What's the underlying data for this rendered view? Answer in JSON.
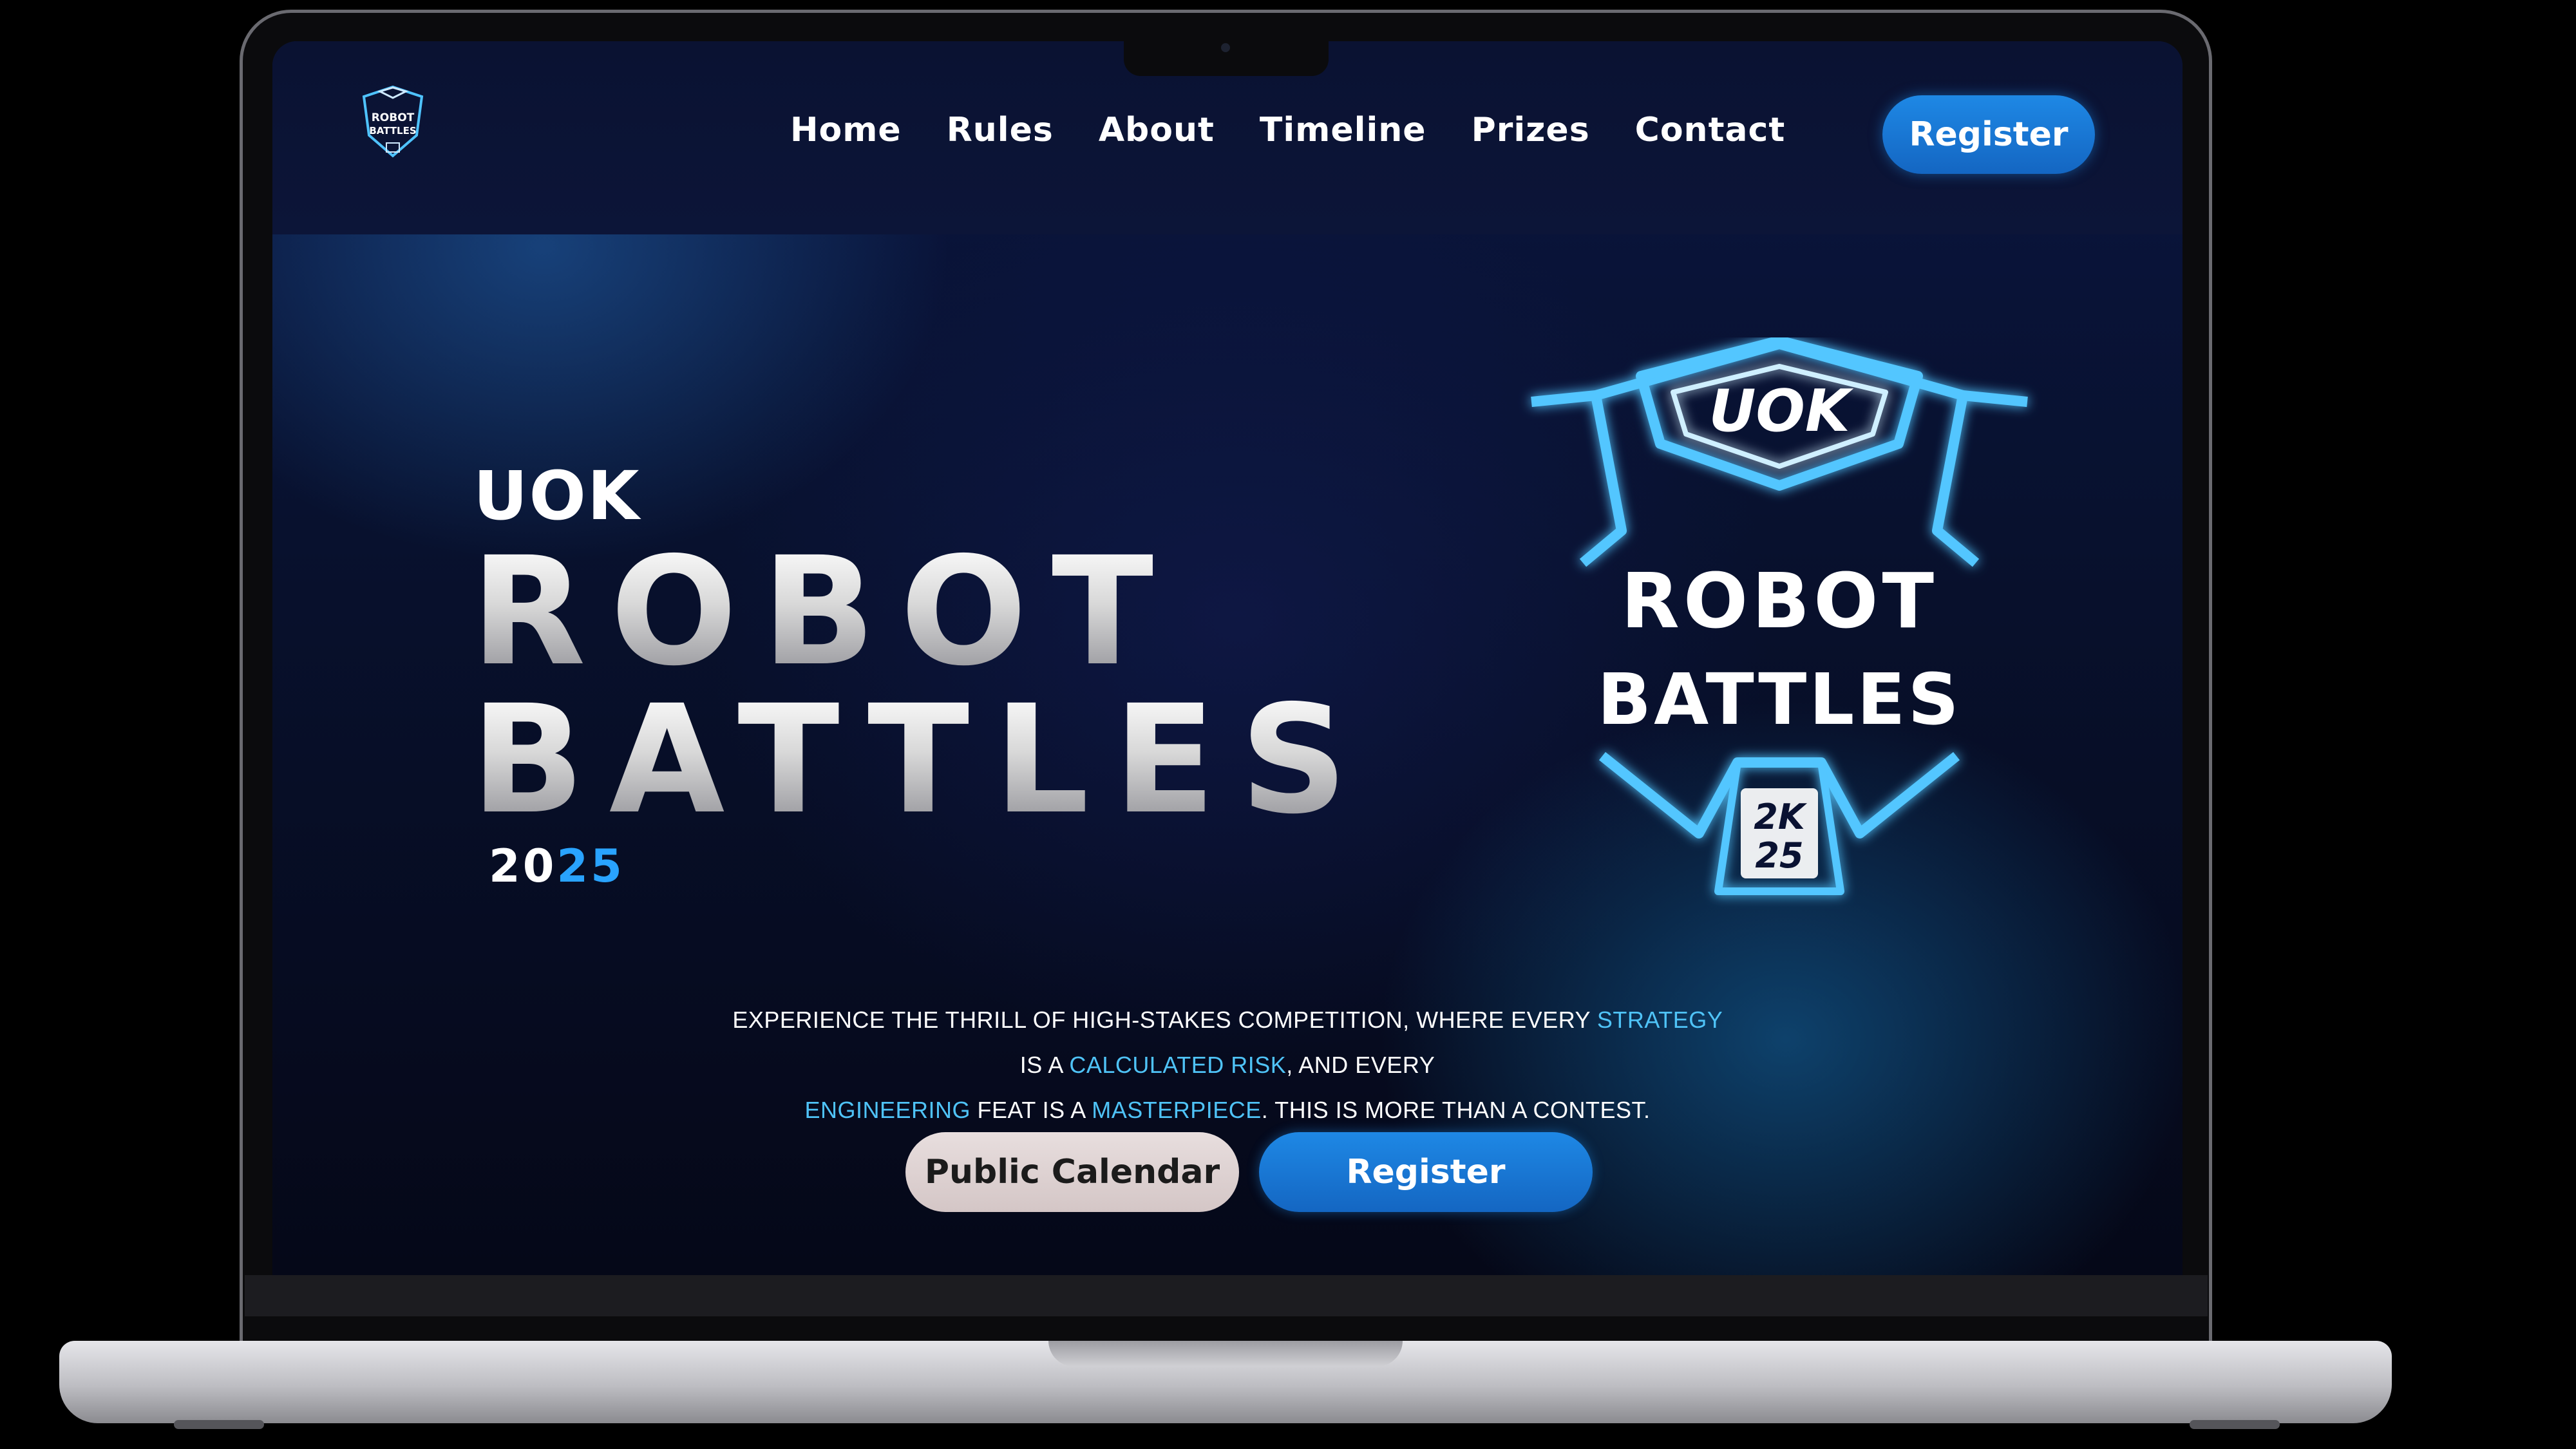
{
  "header": {
    "logo_alt_text": "ROBOT BATTLES",
    "nav": [
      {
        "label": "Home"
      },
      {
        "label": "Rules"
      },
      {
        "label": "About"
      },
      {
        "label": "Timeline"
      },
      {
        "label": "Prizes"
      },
      {
        "label": "Contact"
      }
    ],
    "register_label": "Register"
  },
  "hero": {
    "kicker": "UOK",
    "title_line1": "ROBOT",
    "title_line2": "BATTLES",
    "year_part1": "20",
    "year_part2": "25",
    "logo": {
      "top": "UOK",
      "line1": "ROBOT",
      "line2": "BATTLES",
      "badge_line1": "2K",
      "badge_line2": "25"
    },
    "tagline": {
      "p1": "Experience the thrill of high-stakes competition, where every ",
      "h1": "strategy",
      "p2": " is a ",
      "h2": "calculated risk",
      "p3": ", and every ",
      "h3": "engineering",
      "p4": " feat is a ",
      "h4": "masterpiece",
      "p5": ". This is more than a contest."
    },
    "btn_calendar": "Public Calendar",
    "btn_register": "Register"
  },
  "colors": {
    "accent": "#1e88e5",
    "highlight": "#4fc3f7",
    "year_accent": "#29a3ff",
    "neon": "#4fc3ff"
  },
  "icons": {
    "logo": "robot-battles-shield-logo"
  }
}
